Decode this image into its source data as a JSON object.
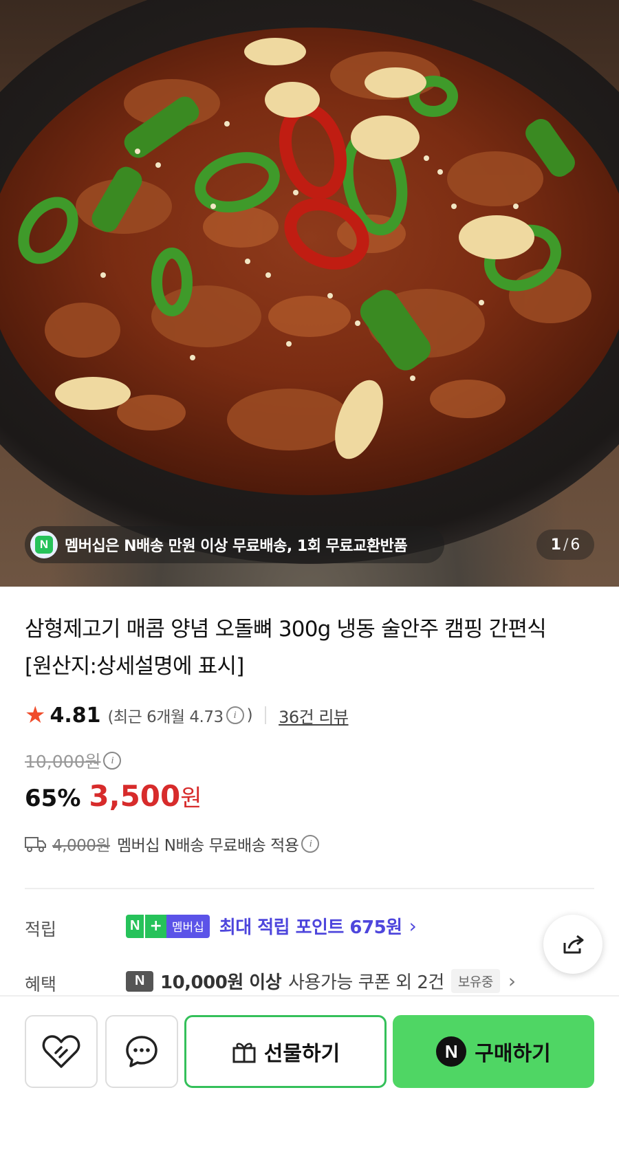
{
  "hero": {
    "image_desc_icon": "food-photo",
    "member_notice": "멤버십은 N배송 만원 이상 무료배송, 1회 무료교환반품",
    "counter_current": "1",
    "counter_sep": "/",
    "counter_total": "6"
  },
  "product": {
    "title": "삼형제고기 매콤 양념 오돌뼈 300g 냉동 술안주 캠핑 간편식 [원산지:상세설명에 표시]",
    "rating": "4.81",
    "recent_rating": "(최근 6개월 4.73",
    "recent_close": ")",
    "review_count": "36건 리뷰",
    "original_price": "10,000원",
    "discount_pct": "65%",
    "sale_price": "3,500",
    "sale_unit": "원",
    "shipping_fee_struck": "4,000원",
    "shipping_text": "멤버십 N배송 무료배송 적용"
  },
  "points": {
    "label": "적립",
    "badge_n": "N",
    "badge_plus": "+",
    "badge_member": "멤버십",
    "text": "최대 적립 포인트 675원"
  },
  "benefit": {
    "label": "혜택",
    "badge_n": "N",
    "amount": "10,000원 이상",
    "rest": "사용가능 쿠폰 외 2건",
    "tag": "보유중"
  },
  "actions": {
    "gift_label": "선물하기",
    "buy_label": "구매하기",
    "buy_badge": "N"
  },
  "colors": {
    "price_red": "#d72b2b",
    "points_purple": "#4e46dc",
    "npay_green": "#4fd664"
  }
}
